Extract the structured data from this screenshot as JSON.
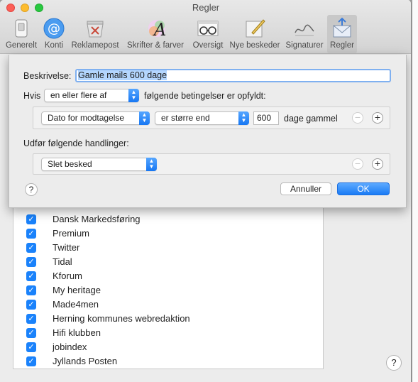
{
  "window": {
    "title": "Regler"
  },
  "toolbar": {
    "items": [
      {
        "label": "Generelt",
        "icon": "phone-switch-icon"
      },
      {
        "label": "Konti",
        "icon": "at-sign-icon"
      },
      {
        "label": "Reklamepost",
        "icon": "junk-mail-icon"
      },
      {
        "label": "Skrifter & farver",
        "icon": "fonts-colors-icon"
      },
      {
        "label": "Oversigt",
        "icon": "glasses-icon"
      },
      {
        "label": "Nye beskeder",
        "icon": "compose-icon"
      },
      {
        "label": "Signaturer",
        "icon": "signature-icon"
      },
      {
        "label": "Regler",
        "icon": "rules-envelope-icon"
      }
    ],
    "active": "Regler"
  },
  "sheet": {
    "description_label": "Beskrivelse:",
    "description_value": "Gamle mails 600 dage",
    "if_label": "Hvis",
    "match_popup": "en eller flere af",
    "conditions_suffix": "følgende betingelser er opfyldt:",
    "condition": {
      "field": "Dato for modtagelse",
      "operator": "er større end",
      "value": "600",
      "unit": "dage gammel"
    },
    "actions_label": "Udfør følgende handlinger:",
    "action": {
      "type": "Slet besked"
    },
    "help": "?",
    "cancel_label": "Annuller",
    "ok_label": "OK"
  },
  "rules_list": {
    "items": [
      "Dansk Markedsføring",
      "Premium",
      "Twitter",
      "Tidal",
      "Kforum",
      "My heritage",
      "Made4men",
      "Herning kommunes webredaktion",
      "Hifi klubben",
      "jobindex",
      "Jyllands Posten"
    ]
  },
  "main": {
    "help": "?"
  },
  "colors": {
    "accent": "#1a82fb",
    "selection": "#b4d6fe",
    "close": "#fc5f57",
    "minimize": "#fdbc2e",
    "zoom": "#28c840"
  }
}
